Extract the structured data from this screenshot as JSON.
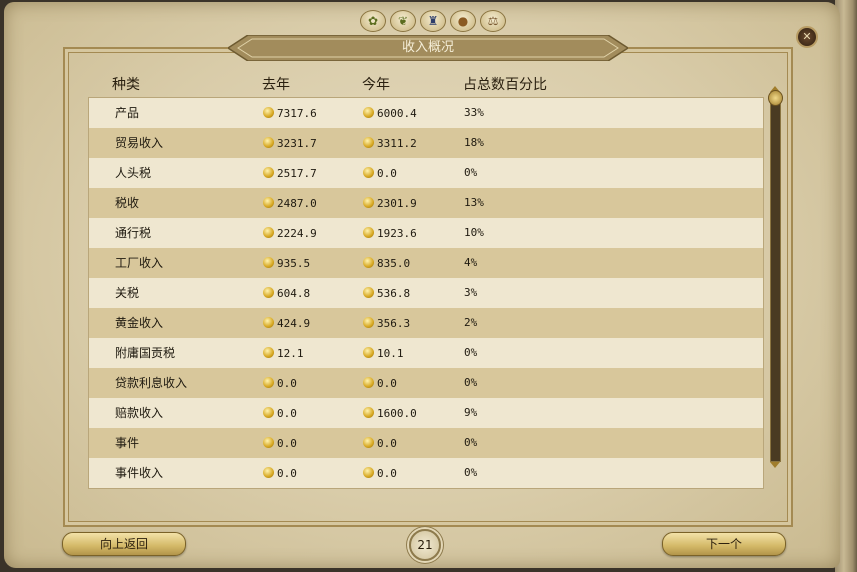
{
  "window": {
    "title": "收入概况"
  },
  "top_icons": [
    "wheat-icon",
    "harvest-icon",
    "castle-icon",
    "money-bag-icon",
    "trade-icon"
  ],
  "columns": {
    "type": "种类",
    "last_year": "去年",
    "this_year": "今年",
    "percent": "占总数百分比"
  },
  "rows": [
    {
      "type": "产品",
      "last_year": "7317.6",
      "this_year": "6000.4",
      "percent": "33%"
    },
    {
      "type": "贸易收入",
      "last_year": "3231.7",
      "this_year": "3311.2",
      "percent": "18%"
    },
    {
      "type": "人头税",
      "last_year": "2517.7",
      "this_year": "0.0",
      "percent": "0%"
    },
    {
      "type": "税收",
      "last_year": "2487.0",
      "this_year": "2301.9",
      "percent": "13%"
    },
    {
      "type": "通行税",
      "last_year": "2224.9",
      "this_year": "1923.6",
      "percent": "10%"
    },
    {
      "type": "工厂收入",
      "last_year": "935.5",
      "this_year": "835.0",
      "percent": "4%"
    },
    {
      "type": "关税",
      "last_year": "604.8",
      "this_year": "536.8",
      "percent": "3%"
    },
    {
      "type": "黄金收入",
      "last_year": "424.9",
      "this_year": "356.3",
      "percent": "2%"
    },
    {
      "type": "附庸国贡税",
      "last_year": "12.1",
      "this_year": "10.1",
      "percent": "0%"
    },
    {
      "type": "贷款利息收入",
      "last_year": "0.0",
      "this_year": "0.0",
      "percent": "0%"
    },
    {
      "type": "赔款收入",
      "last_year": "0.0",
      "this_year": "1600.0",
      "percent": "9%"
    },
    {
      "type": "事件",
      "last_year": "0.0",
      "this_year": "0.0",
      "percent": "0%"
    },
    {
      "type": "事件收入",
      "last_year": "0.0",
      "this_year": "0.0",
      "percent": "0%"
    }
  ],
  "buttons": {
    "back": "向上返回",
    "next": "下一个"
  },
  "page_number": "21",
  "colors": {
    "parchment": "#d9cca9",
    "row_light": "#efe7d0",
    "row_dark": "#d8c79b",
    "gold": "#d6a720"
  }
}
